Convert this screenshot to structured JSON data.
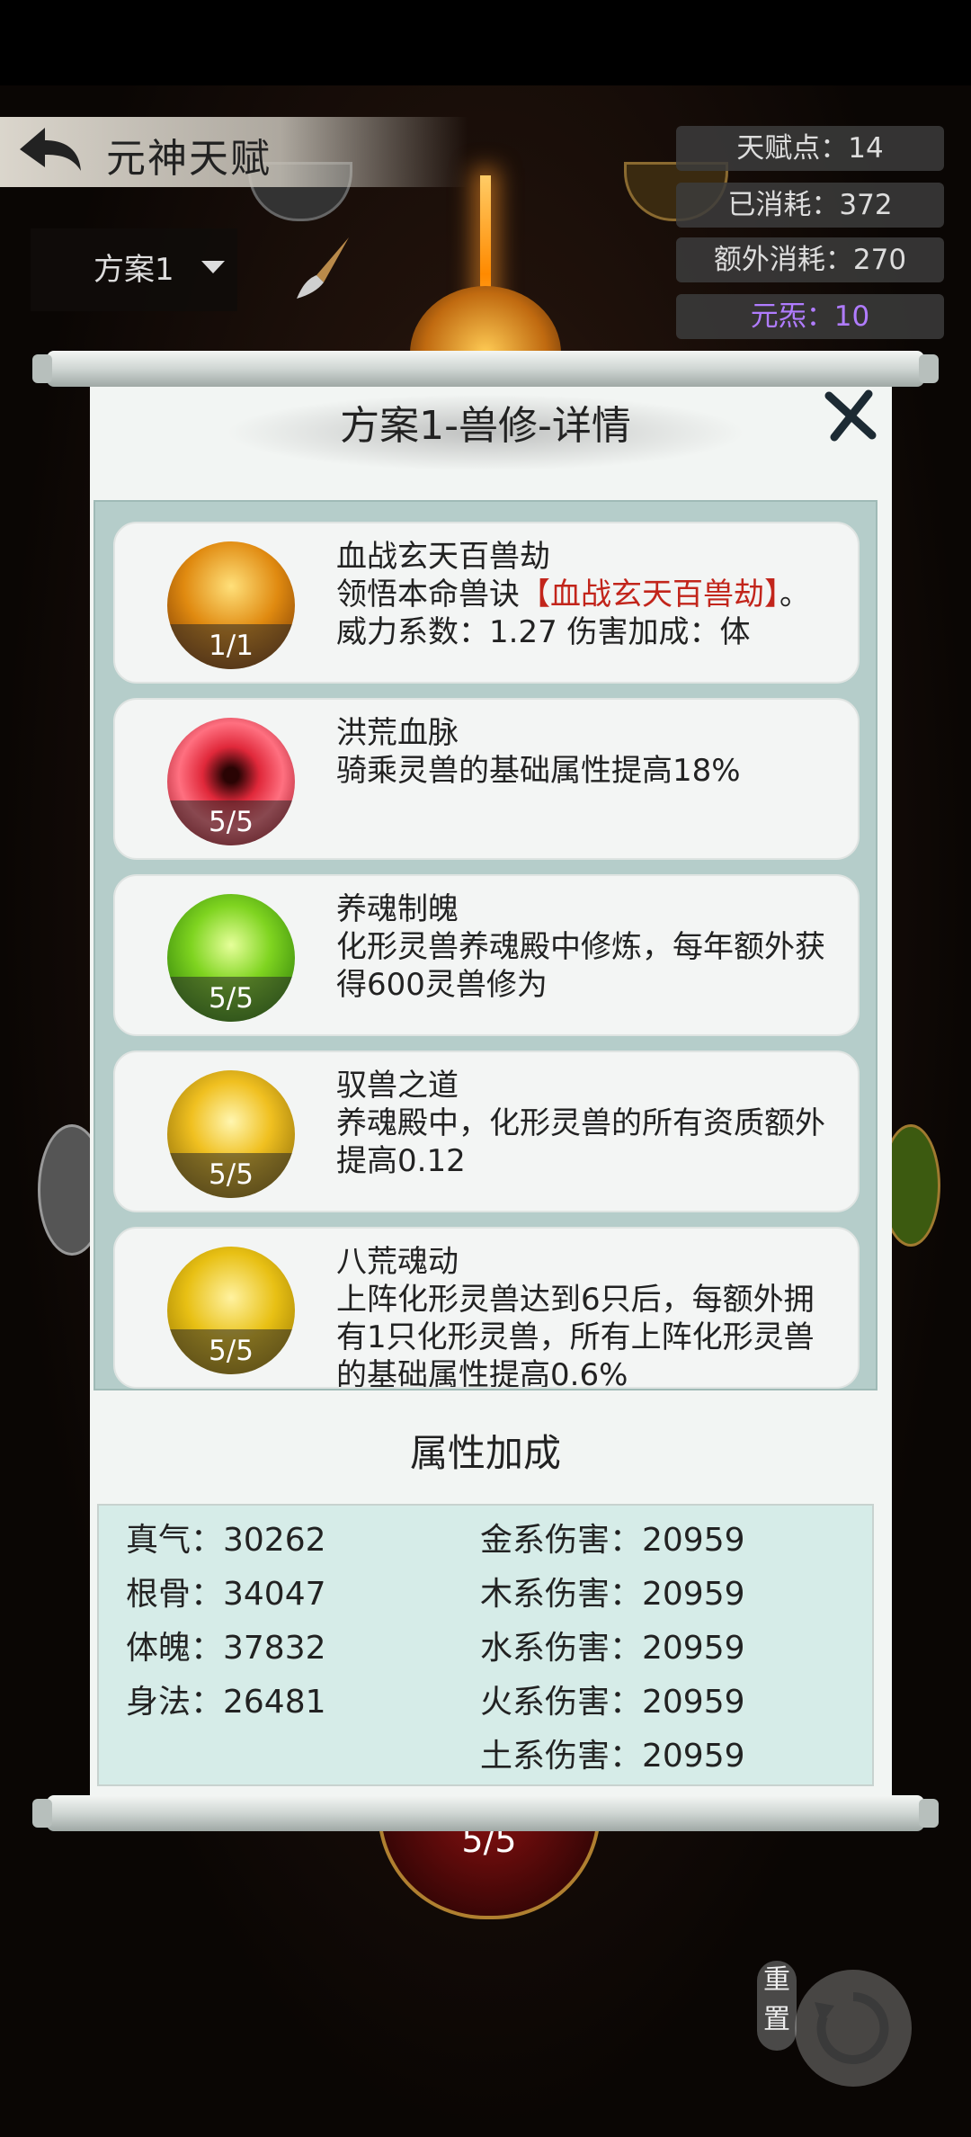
{
  "header": {
    "title": "元神天赋"
  },
  "stats": [
    {
      "text": "天赋点：14"
    },
    {
      "text": "已消耗：372"
    },
    {
      "text": "额外消耗：270"
    },
    {
      "text": "元炁：10"
    }
  ],
  "plan_select": {
    "value": "方案1"
  },
  "dialog": {
    "title": "方案1-兽修-详情",
    "skills": [
      {
        "name": "血战玄天百兽劫",
        "level": "1/1",
        "desc_prefix": "领悟本命兽诀",
        "desc_highlight": "【血战玄天百兽劫】",
        "desc_suffix": "。",
        "desc_line3": "威力系数：1.27 伤害加成：体"
      },
      {
        "name": "洪荒血脉",
        "level": "5/5",
        "desc": "骑乘灵兽的基础属性提高18%"
      },
      {
        "name": "养魂制魄",
        "level": "5/5",
        "desc": "化形灵兽养魂殿中修炼，每年额外获得600灵兽修为"
      },
      {
        "name": "驭兽之道",
        "level": "5/5",
        "desc": "养魂殿中，化形灵兽的所有资质额外提高0.12"
      },
      {
        "name": "八荒魂动",
        "level": "5/5",
        "desc": "上阵化形灵兽达到6只后，每额外拥有1只化形灵兽，所有上阵化形灵兽的基础属性提高0.6%"
      }
    ],
    "attr_title": "属性加成",
    "attrs_left": [
      "真气：30262",
      "根骨：34047",
      "体魄：37832",
      "身法：26481"
    ],
    "attrs_right": [
      "金系伤害：20959",
      "木系伤害：20959",
      "水系伤害：20959",
      "火系伤害：20959",
      "土系伤害：20959"
    ]
  },
  "background": {
    "bottom_node_level": "5/5",
    "reset_label": "重置"
  },
  "colors": {
    "highlight_red": "#c2251b",
    "yuanqi_purple": "#b07cff"
  }
}
